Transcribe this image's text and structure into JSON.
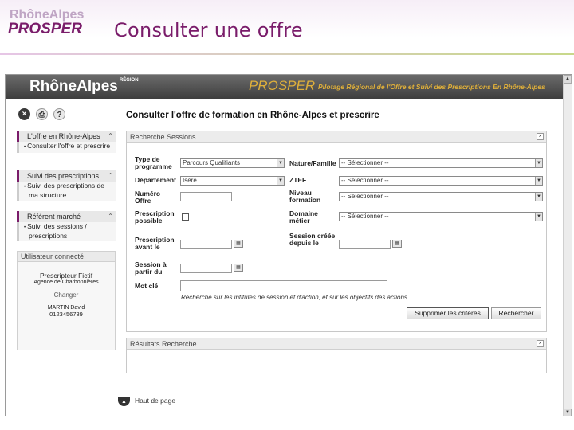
{
  "slide": {
    "logo_top": "RhôneAlpes",
    "logo_bottom": "PROSPER",
    "title": "Consulter une offre"
  },
  "banner": {
    "logo": "RhôneAlpes",
    "logo_sup": "RÉGION",
    "prosper": "PROSPER",
    "subtitle": "Pilotage Régional de l'Offre et Suivi des Prescriptions En Rhône-Alpes"
  },
  "toolbar": {
    "close": "×",
    "print": "⎙",
    "help": "?"
  },
  "sidebar": {
    "sections": [
      {
        "title": "L'offre en Rhône-Alpes",
        "links": [
          "Consulter l'offre et prescrire"
        ]
      },
      {
        "title": "Suivi des prescriptions",
        "links": [
          "Suivi des prescriptions de ma structure"
        ]
      },
      {
        "title": "Référent marché",
        "links": [
          "Suivi des sessions / prescriptions"
        ]
      }
    ],
    "user": {
      "title": "Utilisateur connecté",
      "role": "Prescripteur Fictif",
      "agency": "Agence de Charbonnières",
      "change": "Changer",
      "name": "MARTIN David",
      "phone": "0123456789"
    }
  },
  "main": {
    "title": "Consulter l'offre de formation en Rhône-Alpes et prescrire",
    "search_panel": "Recherche Sessions",
    "results_panel": "Résultats Recherche",
    "fields": {
      "type_label": "Type de programme",
      "type_value": "Parcours Qualifiants",
      "nature_label": "Nature/Famille",
      "nature_value": "-- Sélectionner --",
      "dept_label": "Département",
      "dept_value": "Isère",
      "ztef_label": "ZTEF",
      "ztef_value": "-- Sélectionner --",
      "num_label": "Numéro Offre",
      "niveau_label": "Niveau formation",
      "niveau_value": "-- Sélectionner --",
      "prescription_label": "Prescription possible",
      "domaine_label": "Domaine métier",
      "domaine_value": "-- Sélectionner --",
      "before_label": "Prescription avant le",
      "created_label": "Session créée depuis le",
      "start_label": "Session à partir du",
      "keyword_label": "Mot clé",
      "keyword_hint": "Recherche sur les intitulés de session et d'action, et sur les objectifs des actions."
    },
    "buttons": {
      "clear": "Supprimer les critères",
      "search": "Rechercher"
    },
    "back": "Haut de page"
  }
}
